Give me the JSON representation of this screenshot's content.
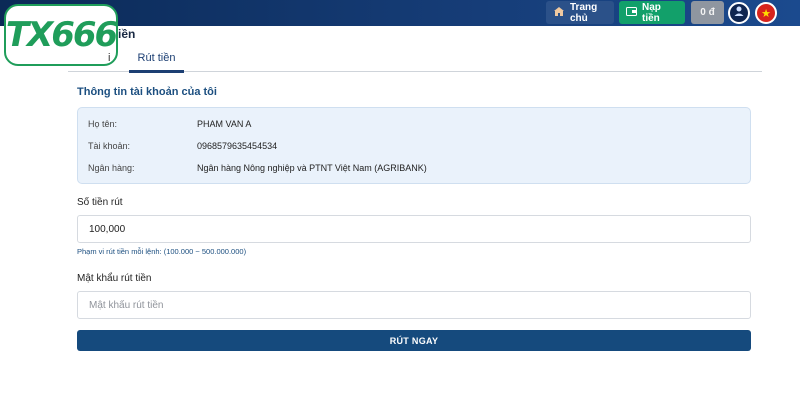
{
  "header": {
    "home_label": "Trang chủ",
    "deposit_label": "Nạp tiền",
    "balance": "0 đ",
    "colors": {
      "bar": "#163d78",
      "deposit": "#12a06a",
      "balance": "#8f96a0",
      "flag": "#d7241d"
    }
  },
  "logo": {
    "text": "TX666",
    "color": "#1f9d5a"
  },
  "page": {
    "title": "iền"
  },
  "tabs": [
    {
      "label": "i",
      "active": false
    },
    {
      "label": "Rút tiền",
      "active": true
    }
  ],
  "account": {
    "section_title": "Thông tin tài khoản của tôi",
    "rows": [
      {
        "label": "Họ tên:",
        "value": "PHAM VAN A"
      },
      {
        "label": "Tài khoản:",
        "value": "0968579635454534"
      },
      {
        "label": "Ngân hàng:",
        "value": "Ngân hàng Nông nghiệp và PTNT Việt Nam (AGRIBANK)"
      }
    ]
  },
  "form": {
    "amount_label": "Số tiền rút",
    "amount_value": "100,000",
    "amount_hint": "Phạm vi rút tiền mỗi lệnh: (100.000 ~ 500.000.000)",
    "password_label": "Mật khẩu rút tiền",
    "password_placeholder": "Mật khẩu rút tiền",
    "submit_label": "RÚT NGAY"
  }
}
